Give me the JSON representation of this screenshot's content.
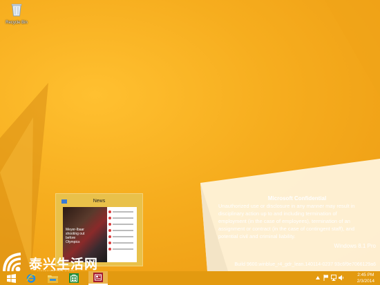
{
  "desktop": {
    "recycle_bin_label": "Recycle Bin"
  },
  "confidential": {
    "title": "Microsoft Confidential",
    "lines": [
      "Unauthorized use or disclosure in any manner may result in",
      "disciplinary action up to and including termination of",
      "employment (in the case of employees), termination of an",
      "assignment or contract (in the case of contingent staff), and",
      "potential civil and criminal liability."
    ]
  },
  "watermark": {
    "edition": "Windows 8.1 Pro",
    "build": "Build 9600.winblue_r4_gdr_lean.140114-0237 93c6f9e7066129a6"
  },
  "thumbnail": {
    "title": "News",
    "caption": "Meyer-Ibaar shooting out before Olympics"
  },
  "overlay_brand": {
    "chinese": "泰兴生活网",
    "url": "www.0523.com"
  },
  "clock": {
    "time": "2:45 PM",
    "date": "2/3/2014"
  },
  "colors": {
    "desktop_bg": "#f6ad1e",
    "taskbar": "#e39a10",
    "news_tile": "#a51c2d"
  },
  "icons": {
    "start": "windows-logo-icon",
    "ie": "internet-explorer-icon",
    "explorer": "file-explorer-icon",
    "store": "store-icon",
    "news": "news-app-icon",
    "tray": [
      "show-hidden-icons-icon",
      "action-center-flag-icon",
      "network-icon",
      "volume-icon"
    ]
  }
}
